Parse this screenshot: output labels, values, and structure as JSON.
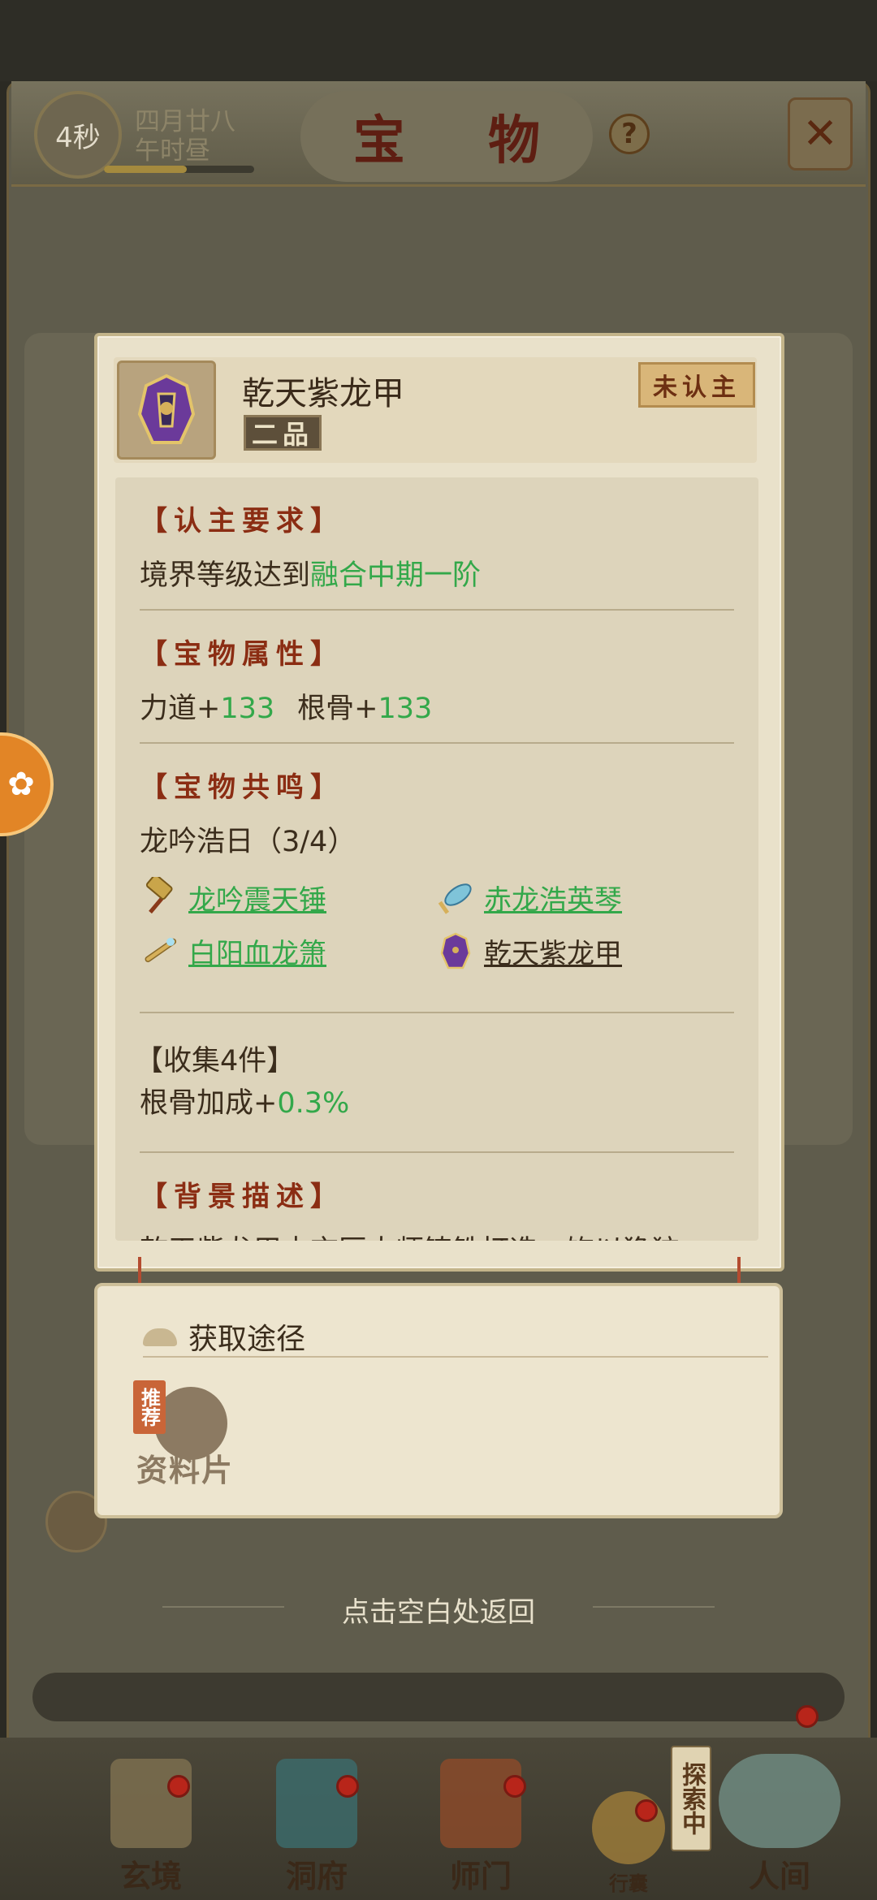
{
  "header": {
    "timer": "4秒",
    "date_line1": "四月廿八",
    "date_line2": "午时昼",
    "progress_fraction": 0.55,
    "title": "宝 物",
    "help": "?",
    "close": "✕"
  },
  "item": {
    "name": "乾天紫龙甲",
    "grade": "二品",
    "status": "未认主",
    "icon": "purple-dragon-armor-icon"
  },
  "sections": {
    "requirement": {
      "title": "【认主要求】",
      "text_prefix": "境界等级达到",
      "text_value": "融合中期一阶"
    },
    "attributes": {
      "title": "【宝物属性】",
      "attr1_label": "力道+",
      "attr1_value": "133",
      "attr2_label": "根骨+",
      "attr2_value": "133"
    },
    "resonance": {
      "title": "【宝物共鸣】",
      "set_name": "龙吟浩日（3/4）",
      "items": [
        {
          "name": "龙吟震天锤",
          "icon": "hammer-icon",
          "owned": false
        },
        {
          "name": "赤龙浩英琴",
          "icon": "zither-icon",
          "owned": false
        },
        {
          "name": "白阳血龙箫",
          "icon": "flute-icon",
          "owned": false
        },
        {
          "name": "乾天紫龙甲",
          "icon": "armor-icon",
          "owned": true
        }
      ]
    },
    "collect": {
      "title": "【收集4件】",
      "bonus_label": "根骨加成+",
      "bonus_value": "0.3%"
    },
    "background": {
      "title": "【背景描述】",
      "text": "乾天紫龙甲由玄匠大师铸铁打造，饰以狰狞"
    }
  },
  "source": {
    "title": "获取途径",
    "recommend_tag": "推荐",
    "item_label": "资料片"
  },
  "return_hint": "点击空白处返回",
  "nav": {
    "items": [
      {
        "label": "玄境",
        "icon": "scroll-icon"
      },
      {
        "label": "洞府",
        "icon": "pavilion-icon"
      },
      {
        "label": "师门",
        "icon": "banner-icon"
      },
      {
        "label": "行囊",
        "icon": "bag-icon"
      },
      {
        "label": "人间",
        "icon": "landscape-icon"
      }
    ],
    "explore_tag": "探索中"
  },
  "colors": {
    "accent_green": "#33a84a",
    "section_red": "#8b2d13",
    "card_bg": "#e9e1ca"
  }
}
